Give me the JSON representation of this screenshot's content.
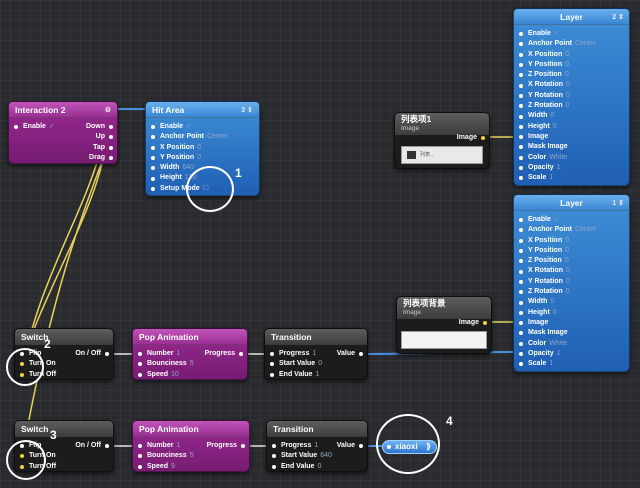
{
  "interaction": {
    "title": "Interaction 2",
    "ctrl": "⚙",
    "enable_label": "Enable",
    "enable_value": "✓",
    "outputs": [
      "Down",
      "Up",
      "Tap",
      "Drag"
    ]
  },
  "hitarea": {
    "title": "Hit Area",
    "ctrl": "3 ⇕",
    "rows": [
      {
        "label": "Enable",
        "value": "✓"
      },
      {
        "label": "Anchor Point",
        "value": "Center"
      },
      {
        "label": "X Position",
        "value": "0"
      },
      {
        "label": "Y Position",
        "value": "0"
      },
      {
        "label": "Width",
        "value": "640"
      },
      {
        "label": "Height",
        "value": "120"
      },
      {
        "label": "Setup Mode",
        "value": "☐"
      }
    ]
  },
  "image1": {
    "title": "列表项1",
    "subtitle": "Image",
    "port": "Image",
    "thumb_text": "列表..."
  },
  "image2": {
    "title": "列表项背景",
    "subtitle": "Image",
    "port": "Image"
  },
  "layer1": {
    "title": "Layer",
    "ctrl": "2 ⇕",
    "rows": [
      {
        "label": "Enable",
        "value": "✓"
      },
      {
        "label": "Anchor Point",
        "value": "Center"
      },
      {
        "label": "X Position",
        "value": "0"
      },
      {
        "label": "Y Position",
        "value": "0"
      },
      {
        "label": "Z Position",
        "value": "0"
      },
      {
        "label": "X Rotation",
        "value": "0"
      },
      {
        "label": "Y Rotation",
        "value": "0"
      },
      {
        "label": "Z Rotation",
        "value": "0"
      },
      {
        "label": "Width",
        "value": "0"
      },
      {
        "label": "Height",
        "value": "0"
      },
      {
        "label": "Image",
        "value": ""
      },
      {
        "label": "Mask Image",
        "value": ""
      },
      {
        "label": "Color",
        "value": "White"
      },
      {
        "label": "Opacity",
        "value": "1"
      },
      {
        "label": "Scale",
        "value": "1"
      }
    ]
  },
  "layer2": {
    "title": "Layer",
    "ctrl": "1 ⇕",
    "rows": [
      {
        "label": "Enable",
        "value": "✓"
      },
      {
        "label": "Anchor Point",
        "value": "Center"
      },
      {
        "label": "X Position",
        "value": "0"
      },
      {
        "label": "Y Position",
        "value": "0"
      },
      {
        "label": "Z Position",
        "value": "0"
      },
      {
        "label": "X Rotation",
        "value": "0"
      },
      {
        "label": "Y Rotation",
        "value": "0"
      },
      {
        "label": "Z Rotation",
        "value": "0"
      },
      {
        "label": "Width",
        "value": "0"
      },
      {
        "label": "Height",
        "value": "0"
      },
      {
        "label": "Image",
        "value": ""
      },
      {
        "label": "Mask Image",
        "value": ""
      },
      {
        "label": "Color",
        "value": "White"
      },
      {
        "label": "Opacity",
        "value": "1"
      },
      {
        "label": "Scale",
        "value": "1"
      }
    ]
  },
  "switch1": {
    "title": "Switch",
    "inputs": [
      "Flip",
      "Turn On",
      "Turn Off"
    ],
    "output": "On / Off"
  },
  "switch2": {
    "title": "Switch",
    "inputs": [
      "Flip",
      "Turn On",
      "Turn Off"
    ],
    "output": "On / Off"
  },
  "pop1": {
    "title": "Pop Animation",
    "rows": [
      {
        "label": "Number",
        "value": "1"
      },
      {
        "label": "Bounciness",
        "value": "5"
      },
      {
        "label": "Speed",
        "value": "10"
      }
    ],
    "output": "Progress"
  },
  "pop2": {
    "title": "Pop Animation",
    "rows": [
      {
        "label": "Number",
        "value": "1"
      },
      {
        "label": "Bounciness",
        "value": "5"
      },
      {
        "label": "Speed",
        "value": "9"
      }
    ],
    "output": "Progress"
  },
  "trans1": {
    "title": "Transition",
    "rows": [
      {
        "label": "Progress",
        "value": "1"
      },
      {
        "label": "Start Value",
        "value": "0"
      },
      {
        "label": "End Value",
        "value": "1"
      }
    ],
    "output": "Value"
  },
  "trans2": {
    "title": "Transition",
    "rows": [
      {
        "label": "Progress",
        "value": "1"
      },
      {
        "label": "Start Value",
        "value": "640"
      },
      {
        "label": "End Value",
        "value": "0"
      }
    ],
    "output": "Value"
  },
  "xiaoxi": {
    "label": "xiaoxi",
    "arrow": "⟫"
  },
  "annotations": [
    "1",
    "2",
    "3",
    "4"
  ],
  "colors": {
    "wire_blue": "#4a90e2",
    "wire_yellow": "#e8d35a",
    "canvas": "#2a2b2f"
  }
}
